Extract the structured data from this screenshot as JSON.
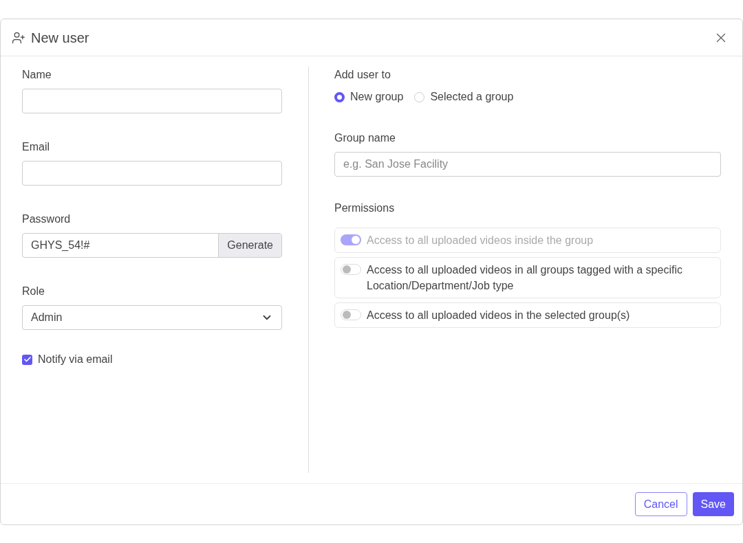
{
  "dialog": {
    "title": "New user"
  },
  "form": {
    "fields": [
      {
        "kind": "text",
        "label": "Name"
      },
      {
        "kind": "text",
        "label": "Email"
      },
      {
        "kind": "password",
        "label": "Password",
        "value": "GHYS_54!#",
        "button": "Generate"
      },
      {
        "kind": "select",
        "label": "Role",
        "value": "Admin"
      }
    ],
    "notify": {
      "label": "Notify via email",
      "checked": true
    }
  },
  "group": {
    "label": "Add user to",
    "options": [
      {
        "label": "New group",
        "selected": true
      },
      {
        "label": "Selected a group",
        "selected": false
      }
    ],
    "name_label": "Group name",
    "name_placeholder": "e.g. San Jose Facility"
  },
  "permissions": {
    "label": "Permissions",
    "items": [
      {
        "label": "Access to all uploaded videos inside the group",
        "on": true,
        "disabled": true
      },
      {
        "label": "Access to all uploaded videos in all groups tagged with a specific Location/Department/Job type",
        "on": false,
        "disabled": false
      },
      {
        "label": "Access to all uploaded videos in the selected group(s)",
        "on": false,
        "disabled": false
      }
    ]
  },
  "buttons": {
    "cancel": "Cancel",
    "save": "Save"
  }
}
